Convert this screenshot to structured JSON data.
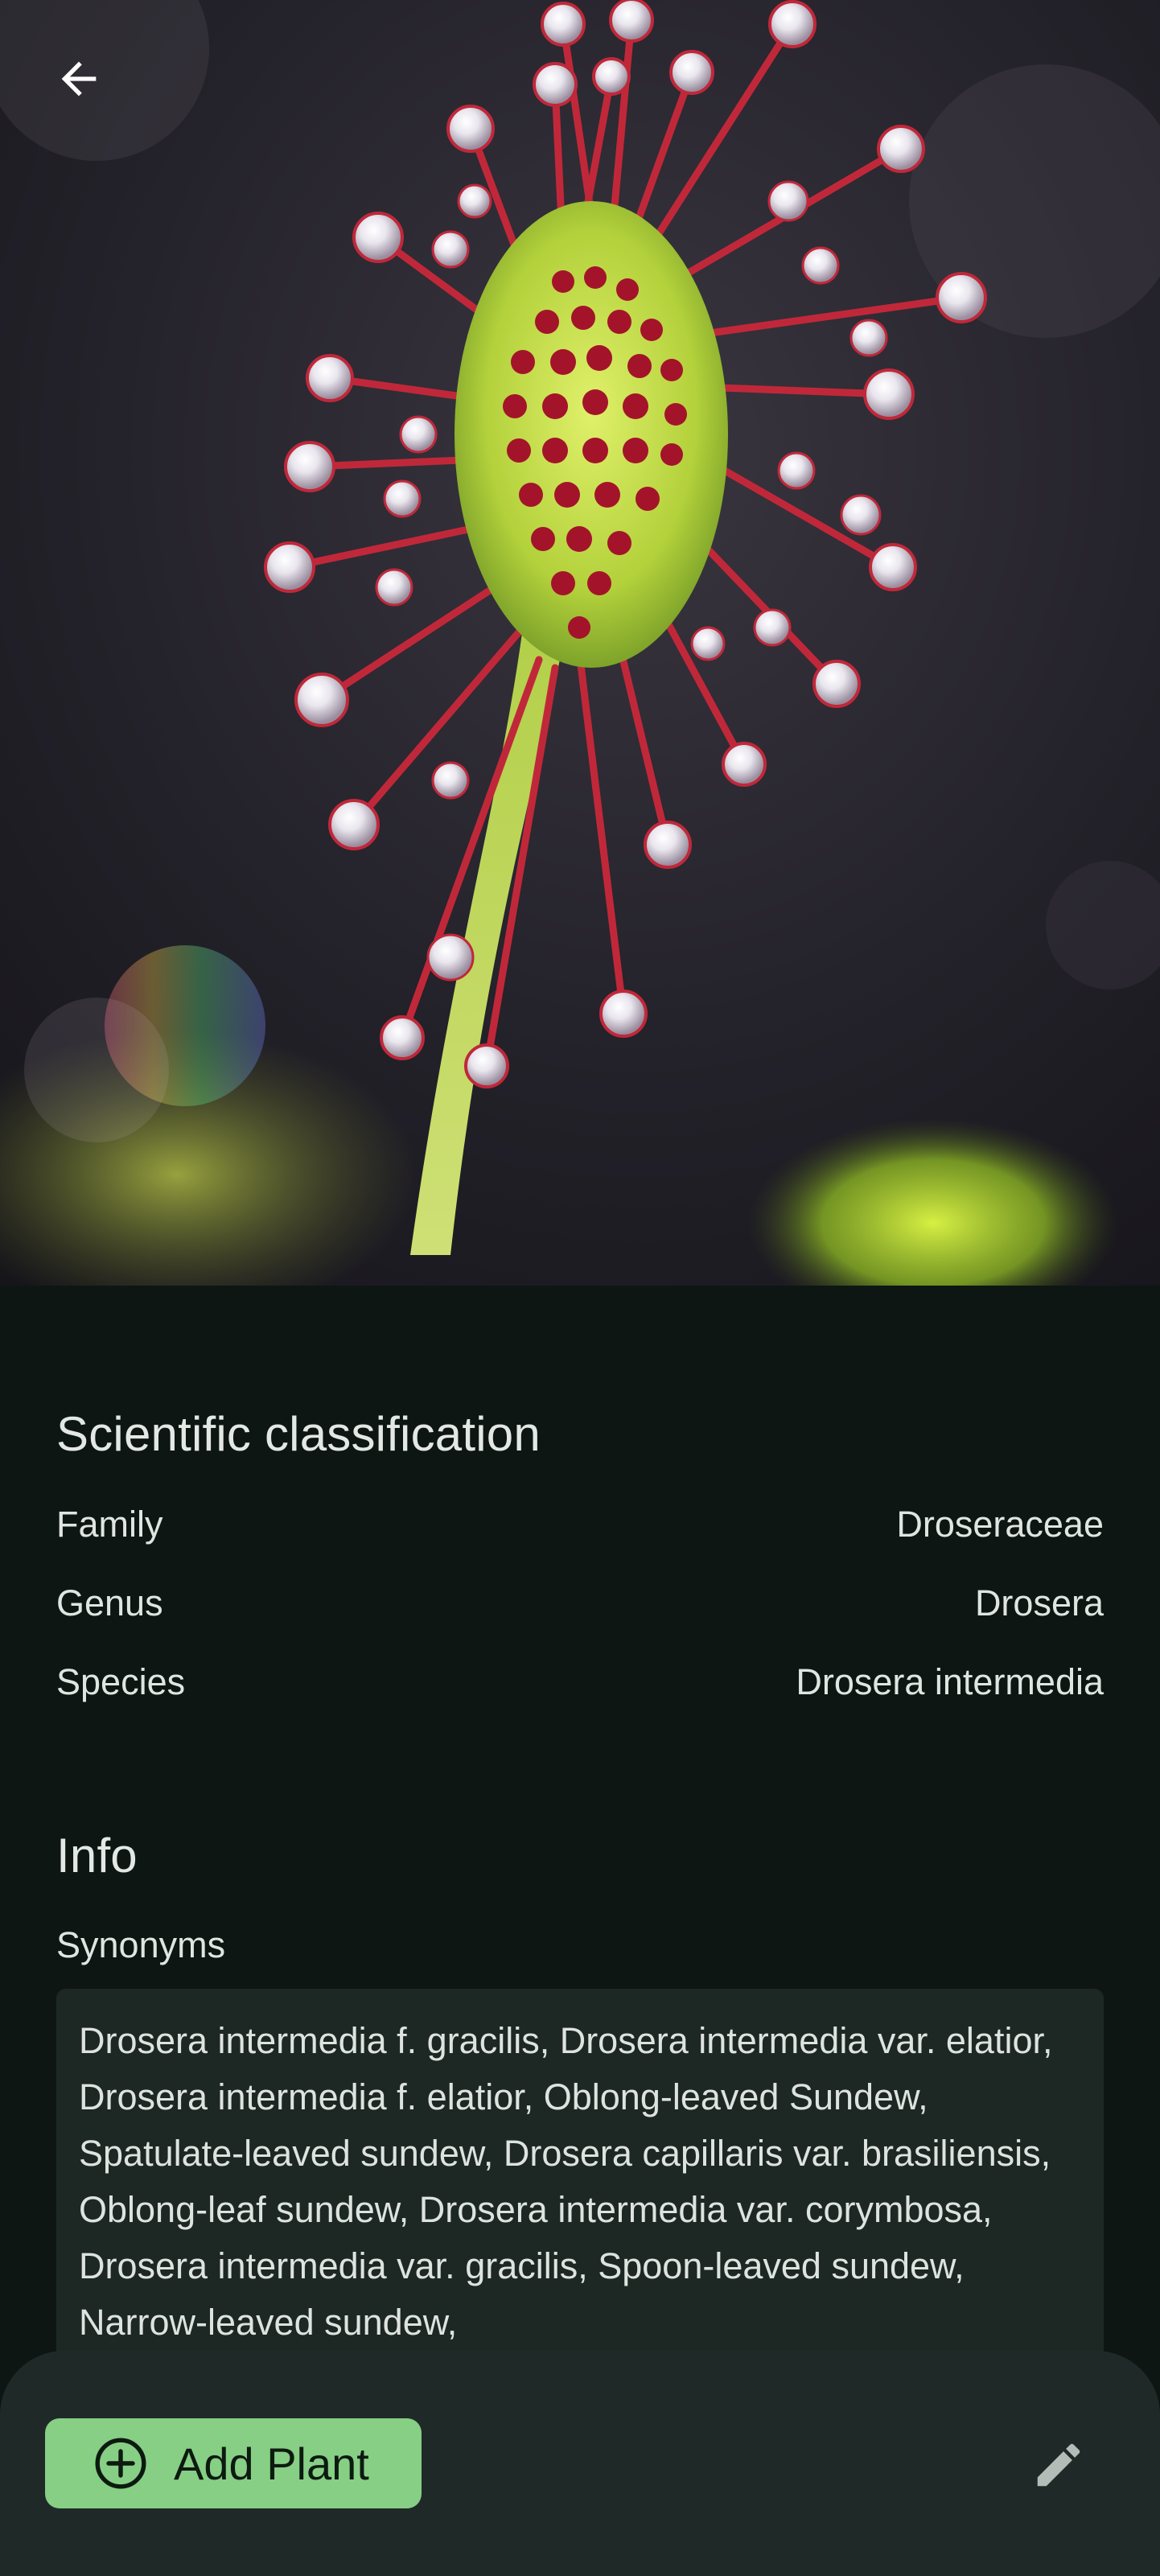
{
  "header": {
    "back_icon": "arrow-left-icon",
    "photo_subject": "plant-photo"
  },
  "classification": {
    "title": "Scientific classification",
    "rows": [
      {
        "label": "Family",
        "value": "Droseraceae"
      },
      {
        "label": "Genus",
        "value": "Drosera"
      },
      {
        "label": "Species",
        "value": "Drosera intermedia"
      }
    ]
  },
  "info": {
    "title": "Info",
    "synonyms_label": "Synonyms",
    "synonyms_text": "Drosera intermedia f. gracilis, Drosera intermedia var. elatior, Drosera intermedia f. elatior, Oblong-leaved Sundew, Spatulate-leaved sundew, Drosera capillaris var. brasiliensis, Oblong-leaf sundew, Drosera intermedia var. corymbosa, Drosera intermedia var. gracilis, Spoon-leaved sundew, Narrow-leaved sundew,"
  },
  "bottom_bar": {
    "add_label": "Add Plant",
    "add_icon": "plus-circle-icon",
    "edit_icon": "pencil-icon"
  },
  "colors": {
    "background": "#0e1613",
    "surface": "#1f2a28",
    "synonyms_box": "#1d2724",
    "accent": "#86cf85",
    "text": "#e3e8e5"
  }
}
